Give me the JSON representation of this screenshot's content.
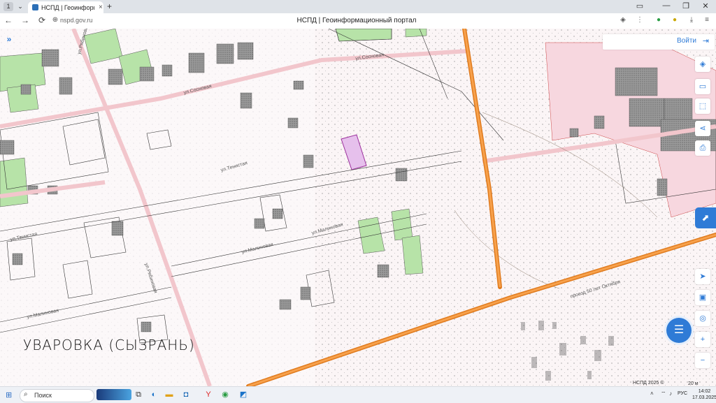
{
  "browser": {
    "tab_title": "НСПД | Геоинформацио",
    "tab_close": "×",
    "new_tab": "+",
    "url": "nspd.gov.ru",
    "page_title": "НСПД | Геоинформационный портал",
    "window_controls": [
      "▭",
      "—",
      "❐",
      "✕"
    ],
    "nav": {
      "back": "←",
      "forward": "→",
      "reload": "⟳"
    }
  },
  "map": {
    "login_label": "Войти",
    "login_icon": "login-arrow-icon",
    "expand_icon": "»",
    "city_label": "УВАРОВКА  (СЫЗРАНЬ)",
    "streets": [
      {
        "name": "ул.Сосновая"
      },
      {
        "name": "ул.Сосновая"
      },
      {
        "name": "ул.Тенистая"
      },
      {
        "name": "ул.Тенистая"
      },
      {
        "name": "ул.Малиновая"
      },
      {
        "name": "ул.Малиновая"
      },
      {
        "name": "ул.Малиновая"
      },
      {
        "name": "ул.Рябиновая"
      },
      {
        "name": "ул.Рябиновая"
      },
      {
        "name": "проезд 50 лет Октября"
      }
    ],
    "scale_text": "НСПД 2025 ©",
    "scale_bar": "20 м",
    "right_tools": [
      "layers-icon",
      "ruler-icon",
      "select-area-icon",
      "share-icon",
      "print-icon"
    ],
    "bottom_tools": [
      "navigate-icon",
      "screen-icon",
      "location-icon",
      "zoom-in-icon",
      "zoom-out-icon"
    ],
    "colors": {
      "road": "#f2912a",
      "parcel_green": "#b7e3a8",
      "selected": "#e6c0ec",
      "pink": "#f7d7df",
      "building": "#8f8f8f",
      "accent": "#2f7bd6"
    }
  },
  "taskbar": {
    "search_label": "Поиск",
    "lang": "РУС",
    "time": "14:02",
    "date": "17.03.2025"
  }
}
